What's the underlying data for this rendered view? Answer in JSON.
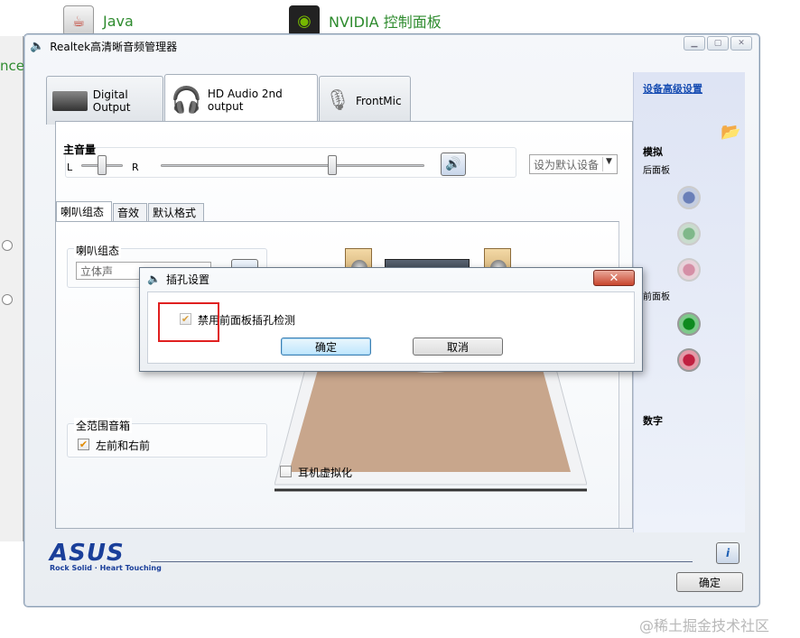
{
  "desktop": {
    "icons": [
      {
        "label": "Java"
      },
      {
        "label": "NVIDIA 控制面板"
      }
    ],
    "side_fragment": "nce"
  },
  "window": {
    "title": "Realtek高清晰音频管理器",
    "device_tabs": [
      {
        "label": "Digital Output"
      },
      {
        "label": "HD Audio 2nd output"
      },
      {
        "label": "FrontMic"
      }
    ],
    "master_volume": {
      "label": "主音量",
      "left": "L",
      "right": "R",
      "balance": 0.5,
      "volume": 0.65
    },
    "default_device_label": "设为默认设备",
    "inner_tabs": [
      {
        "label": "喇叭组态"
      },
      {
        "label": "音效"
      },
      {
        "label": "默认格式"
      }
    ],
    "speaker_config": {
      "label": "喇叭组态",
      "selected": "立体声"
    },
    "fullrange": {
      "label": "全范围音箱",
      "checkbox_label": "左前和右前"
    },
    "headphone_virtualization": "耳机虚拟化",
    "sidebar": {
      "advanced_link": "设备高级设置",
      "analog": "模拟",
      "back_panel": "后面板",
      "front_panel": "前面板",
      "digital": "数字"
    },
    "brand": {
      "logo": "ASUS",
      "tagline": "Rock Solid · Heart Touching"
    },
    "ok_label": "确定"
  },
  "dialog": {
    "title": "插孔设置",
    "close": "✕",
    "checkbox_label": "禁用前面板插孔检测",
    "ok_label": "确定",
    "cancel_label": "取消"
  },
  "watermark": "@稀土掘金技术社区",
  "colors": {
    "accent_link": "#1a4fb3",
    "highlight_red": "#e02020",
    "desktop_label": "#2e8b2e"
  }
}
